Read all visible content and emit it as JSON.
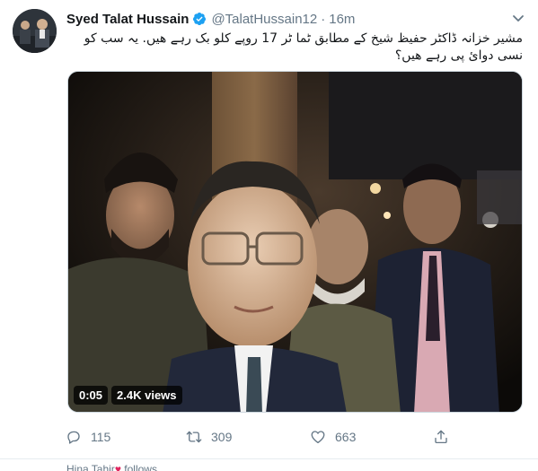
{
  "tweet": {
    "display_name": "Syed Talat Hussain",
    "handle": "@TalatHussain12",
    "separator": "·",
    "time": "16m",
    "text": "مشیر خزانہ ڈاکٹر حفیظ شیخ کے مطابق ٹما ٹر 17 روپے کلو بک رہے ھیں. یہ سب کو نسی دوائ پی رہے ھیں؟",
    "video": {
      "duration": "0:05",
      "views": "2.4K views"
    },
    "actions": {
      "reply_count": "115",
      "retweet_count": "309",
      "like_count": "663"
    },
    "icons": {
      "verified": "verified-badge-icon",
      "caret": "chevron-down-icon",
      "reply": "reply-icon",
      "retweet": "retweet-icon",
      "like": "heart-icon",
      "share": "share-icon"
    },
    "colors": {
      "verified": "#1da1f2",
      "secondary_text": "#657786",
      "like_heart": "#e0245e"
    }
  },
  "next_tweet_preview": {
    "text": "Hina Tahir",
    "suffix": " follows"
  }
}
